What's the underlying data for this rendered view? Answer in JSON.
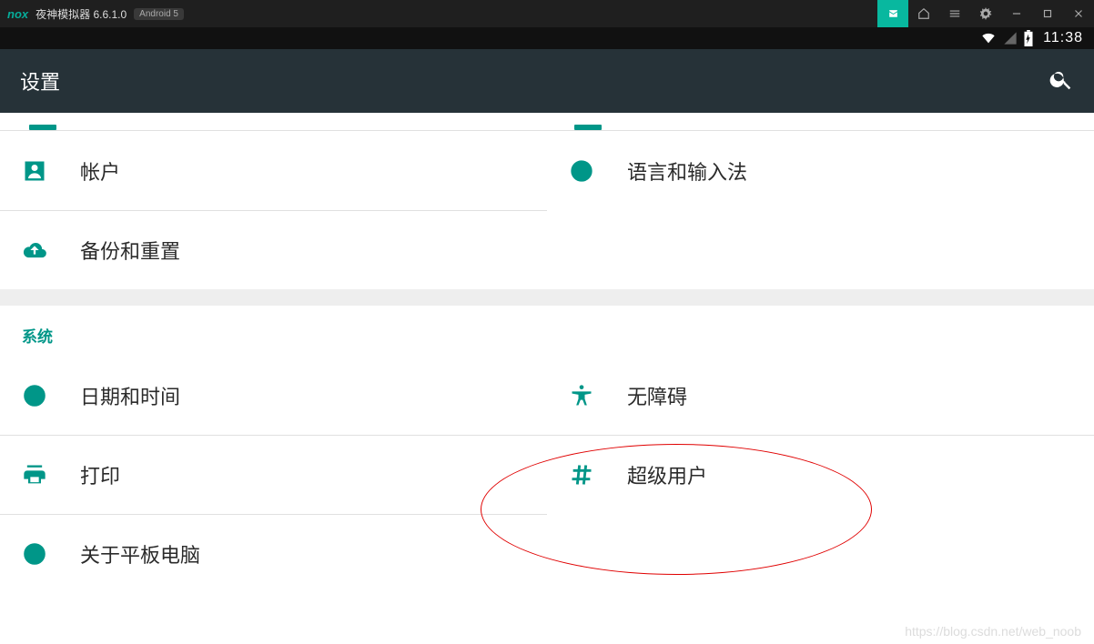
{
  "nox": {
    "logo": "nox",
    "title": "夜神模拟器 6.6.1.0",
    "badge": "Android 5"
  },
  "status": {
    "time": "11:38"
  },
  "appbar": {
    "title": "设置"
  },
  "personal": {
    "account": "帐户",
    "language": "语言和输入法",
    "backup": "备份和重置"
  },
  "system": {
    "header": "系统",
    "datetime": "日期和时间",
    "accessibility": "无障碍",
    "printing": "打印",
    "superuser": "超级用户",
    "about": "关于平板电脑"
  },
  "watermark": "https://blog.csdn.net/web_noob"
}
